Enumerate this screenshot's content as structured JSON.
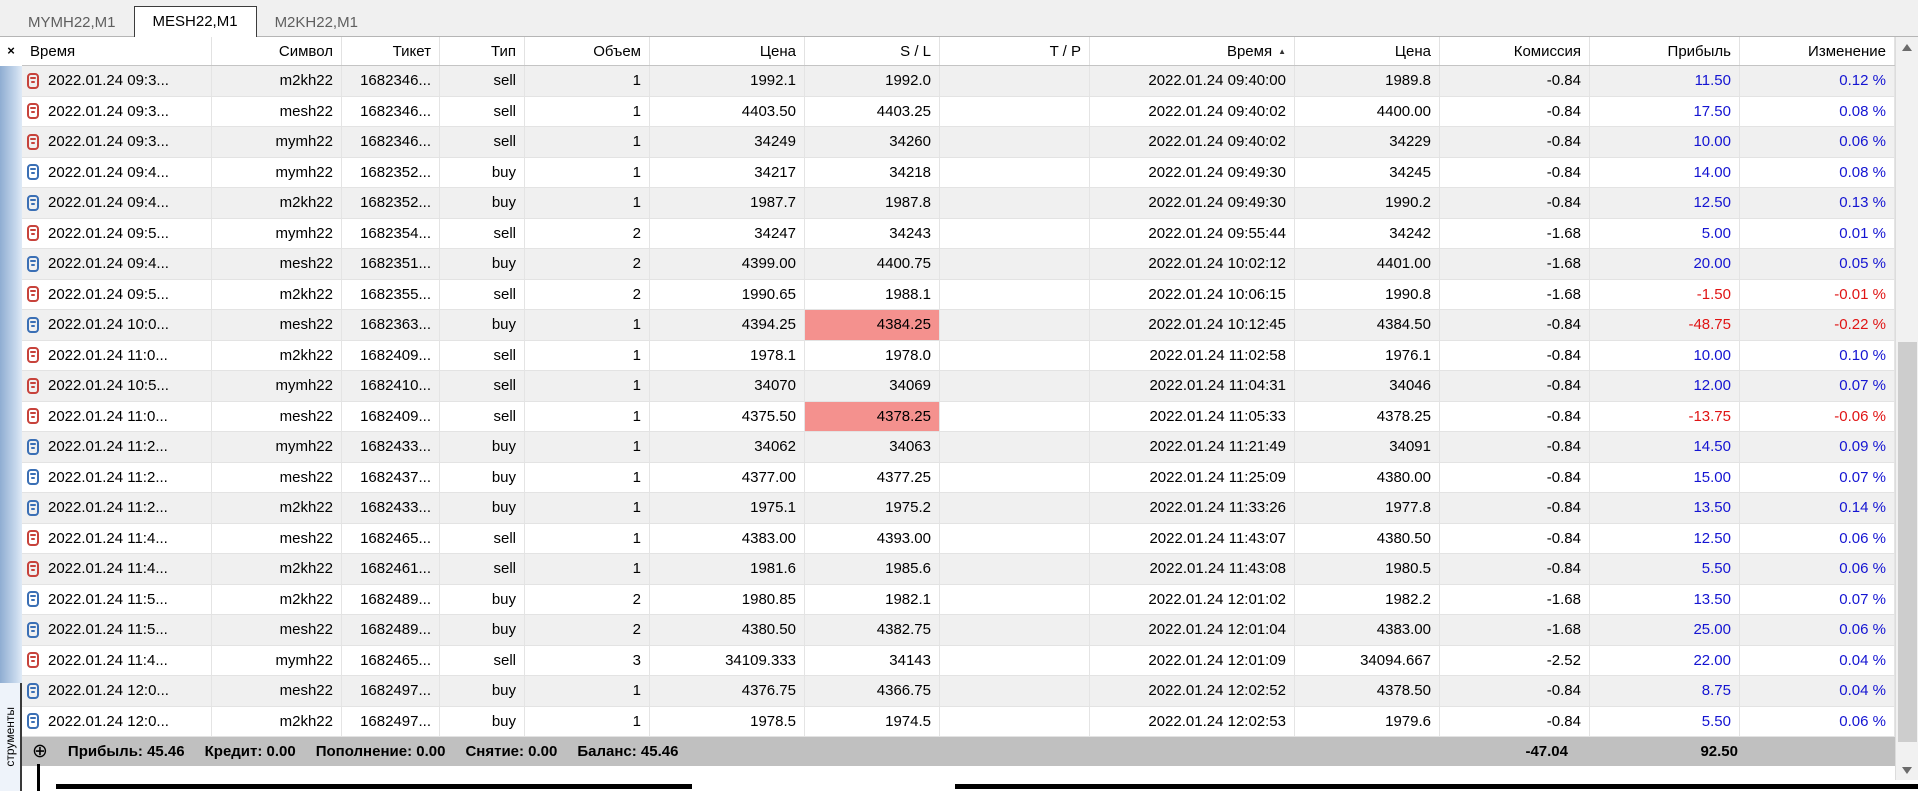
{
  "icons": {
    "close": "×",
    "sort_asc": "▲",
    "expand": "⊕"
  },
  "colors": {
    "profit_positive": "#1414d2",
    "profit_negative": "#e01414",
    "sl_alert_background": "#f4918e",
    "sell_icon": "#c7423b",
    "buy_icon": "#3a6fb5",
    "row_stripe": "#f0f0f0",
    "summary_background": "#c0c0c0",
    "sidebar_gradient": "#8fadd2"
  },
  "tabs": [
    {
      "label": "MYMH22,M1",
      "active": false
    },
    {
      "label": "MESH22,M1",
      "active": true
    },
    {
      "label": "M2KH22,M1",
      "active": false
    }
  ],
  "left_panel": {
    "vertical_label": "струменты"
  },
  "table": {
    "columns": [
      {
        "label": "Время",
        "align": "left"
      },
      {
        "label": "Символ",
        "align": "right"
      },
      {
        "label": "Тикет",
        "align": "right"
      },
      {
        "label": "Тип",
        "align": "right"
      },
      {
        "label": "Объем",
        "align": "right"
      },
      {
        "label": "Цена",
        "align": "right"
      },
      {
        "label": "S / L",
        "align": "right"
      },
      {
        "label": "T / P",
        "align": "right"
      },
      {
        "label": "Время",
        "align": "right",
        "sort": "asc"
      },
      {
        "label": "Цена",
        "align": "right"
      },
      {
        "label": "Комиссия",
        "align": "right"
      },
      {
        "label": "Прибыль",
        "align": "right"
      },
      {
        "label": "Изменение",
        "align": "right"
      }
    ],
    "rows": [
      {
        "time_open": "2022.01.24 09:3...",
        "symbol": "m2kh22",
        "ticket": "1682346...",
        "type": "sell",
        "volume": "1",
        "price_open": "1992.1",
        "sl": "1992.0",
        "tp": "",
        "time_close": "2022.01.24 09:40:00",
        "price_close": "1989.8",
        "commission": "-0.84",
        "profit": "11.50",
        "change": "0.12 %",
        "sl_alert": false
      },
      {
        "time_open": "2022.01.24 09:3...",
        "symbol": "mesh22",
        "ticket": "1682346...",
        "type": "sell",
        "volume": "1",
        "price_open": "4403.50",
        "sl": "4403.25",
        "tp": "",
        "time_close": "2022.01.24 09:40:02",
        "price_close": "4400.00",
        "commission": "-0.84",
        "profit": "17.50",
        "change": "0.08 %",
        "sl_alert": false
      },
      {
        "time_open": "2022.01.24 09:3...",
        "symbol": "mymh22",
        "ticket": "1682346...",
        "type": "sell",
        "volume": "1",
        "price_open": "34249",
        "sl": "34260",
        "tp": "",
        "time_close": "2022.01.24 09:40:02",
        "price_close": "34229",
        "commission": "-0.84",
        "profit": "10.00",
        "change": "0.06 %",
        "sl_alert": false
      },
      {
        "time_open": "2022.01.24 09:4...",
        "symbol": "mymh22",
        "ticket": "1682352...",
        "type": "buy",
        "volume": "1",
        "price_open": "34217",
        "sl": "34218",
        "tp": "",
        "time_close": "2022.01.24 09:49:30",
        "price_close": "34245",
        "commission": "-0.84",
        "profit": "14.00",
        "change": "0.08 %",
        "sl_alert": false
      },
      {
        "time_open": "2022.01.24 09:4...",
        "symbol": "m2kh22",
        "ticket": "1682352...",
        "type": "buy",
        "volume": "1",
        "price_open": "1987.7",
        "sl": "1987.8",
        "tp": "",
        "time_close": "2022.01.24 09:49:30",
        "price_close": "1990.2",
        "commission": "-0.84",
        "profit": "12.50",
        "change": "0.13 %",
        "sl_alert": false
      },
      {
        "time_open": "2022.01.24 09:5...",
        "symbol": "mymh22",
        "ticket": "1682354...",
        "type": "sell",
        "volume": "2",
        "price_open": "34247",
        "sl": "34243",
        "tp": "",
        "time_close": "2022.01.24 09:55:44",
        "price_close": "34242",
        "commission": "-1.68",
        "profit": "5.00",
        "change": "0.01 %",
        "sl_alert": false
      },
      {
        "time_open": "2022.01.24 09:4...",
        "symbol": "mesh22",
        "ticket": "1682351...",
        "type": "buy",
        "volume": "2",
        "price_open": "4399.00",
        "sl": "4400.75",
        "tp": "",
        "time_close": "2022.01.24 10:02:12",
        "price_close": "4401.00",
        "commission": "-1.68",
        "profit": "20.00",
        "change": "0.05 %",
        "sl_alert": false
      },
      {
        "time_open": "2022.01.24 09:5...",
        "symbol": "m2kh22",
        "ticket": "1682355...",
        "type": "sell",
        "volume": "2",
        "price_open": "1990.65",
        "sl": "1988.1",
        "tp": "",
        "time_close": "2022.01.24 10:06:15",
        "price_close": "1990.8",
        "commission": "-1.68",
        "profit": "-1.50",
        "change": "-0.01 %",
        "sl_alert": false
      },
      {
        "time_open": "2022.01.24 10:0...",
        "symbol": "mesh22",
        "ticket": "1682363...",
        "type": "buy",
        "volume": "1",
        "price_open": "4394.25",
        "sl": "4384.25",
        "tp": "",
        "time_close": "2022.01.24 10:12:45",
        "price_close": "4384.50",
        "commission": "-0.84",
        "profit": "-48.75",
        "change": "-0.22 %",
        "sl_alert": true
      },
      {
        "time_open": "2022.01.24 11:0...",
        "symbol": "m2kh22",
        "ticket": "1682409...",
        "type": "sell",
        "volume": "1",
        "price_open": "1978.1",
        "sl": "1978.0",
        "tp": "",
        "time_close": "2022.01.24 11:02:58",
        "price_close": "1976.1",
        "commission": "-0.84",
        "profit": "10.00",
        "change": "0.10 %",
        "sl_alert": false
      },
      {
        "time_open": "2022.01.24 10:5...",
        "symbol": "mymh22",
        "ticket": "1682410...",
        "type": "sell",
        "volume": "1",
        "price_open": "34070",
        "sl": "34069",
        "tp": "",
        "time_close": "2022.01.24 11:04:31",
        "price_close": "34046",
        "commission": "-0.84",
        "profit": "12.00",
        "change": "0.07 %",
        "sl_alert": false
      },
      {
        "time_open": "2022.01.24 11:0...",
        "symbol": "mesh22",
        "ticket": "1682409...",
        "type": "sell",
        "volume": "1",
        "price_open": "4375.50",
        "sl": "4378.25",
        "tp": "",
        "time_close": "2022.01.24 11:05:33",
        "price_close": "4378.25",
        "commission": "-0.84",
        "profit": "-13.75",
        "change": "-0.06 %",
        "sl_alert": true
      },
      {
        "time_open": "2022.01.24 11:2...",
        "symbol": "mymh22",
        "ticket": "1682433...",
        "type": "buy",
        "volume": "1",
        "price_open": "34062",
        "sl": "34063",
        "tp": "",
        "time_close": "2022.01.24 11:21:49",
        "price_close": "34091",
        "commission": "-0.84",
        "profit": "14.50",
        "change": "0.09 %",
        "sl_alert": false
      },
      {
        "time_open": "2022.01.24 11:2...",
        "symbol": "mesh22",
        "ticket": "1682437...",
        "type": "buy",
        "volume": "1",
        "price_open": "4377.00",
        "sl": "4377.25",
        "tp": "",
        "time_close": "2022.01.24 11:25:09",
        "price_close": "4380.00",
        "commission": "-0.84",
        "profit": "15.00",
        "change": "0.07 %",
        "sl_alert": false
      },
      {
        "time_open": "2022.01.24 11:2...",
        "symbol": "m2kh22",
        "ticket": "1682433...",
        "type": "buy",
        "volume": "1",
        "price_open": "1975.1",
        "sl": "1975.2",
        "tp": "",
        "time_close": "2022.01.24 11:33:26",
        "price_close": "1977.8",
        "commission": "-0.84",
        "profit": "13.50",
        "change": "0.14 %",
        "sl_alert": false
      },
      {
        "time_open": "2022.01.24 11:4...",
        "symbol": "mesh22",
        "ticket": "1682465...",
        "type": "sell",
        "volume": "1",
        "price_open": "4383.00",
        "sl": "4393.00",
        "tp": "",
        "time_close": "2022.01.24 11:43:07",
        "price_close": "4380.50",
        "commission": "-0.84",
        "profit": "12.50",
        "change": "0.06 %",
        "sl_alert": false
      },
      {
        "time_open": "2022.01.24 11:4...",
        "symbol": "m2kh22",
        "ticket": "1682461...",
        "type": "sell",
        "volume": "1",
        "price_open": "1981.6",
        "sl": "1985.6",
        "tp": "",
        "time_close": "2022.01.24 11:43:08",
        "price_close": "1980.5",
        "commission": "-0.84",
        "profit": "5.50",
        "change": "0.06 %",
        "sl_alert": false
      },
      {
        "time_open": "2022.01.24 11:5...",
        "symbol": "m2kh22",
        "ticket": "1682489...",
        "type": "buy",
        "volume": "2",
        "price_open": "1980.85",
        "sl": "1982.1",
        "tp": "",
        "time_close": "2022.01.24 12:01:02",
        "price_close": "1982.2",
        "commission": "-1.68",
        "profit": "13.50",
        "change": "0.07 %",
        "sl_alert": false
      },
      {
        "time_open": "2022.01.24 11:5...",
        "symbol": "mesh22",
        "ticket": "1682489...",
        "type": "buy",
        "volume": "2",
        "price_open": "4380.50",
        "sl": "4382.75",
        "tp": "",
        "time_close": "2022.01.24 12:01:04",
        "price_close": "4383.00",
        "commission": "-1.68",
        "profit": "25.00",
        "change": "0.06 %",
        "sl_alert": false
      },
      {
        "time_open": "2022.01.24 11:4...",
        "symbol": "mymh22",
        "ticket": "1682465...",
        "type": "sell",
        "volume": "3",
        "price_open": "34109.333",
        "sl": "34143",
        "tp": "",
        "time_close": "2022.01.24 12:01:09",
        "price_close": "34094.667",
        "commission": "-2.52",
        "profit": "22.00",
        "change": "0.04 %",
        "sl_alert": false
      },
      {
        "time_open": "2022.01.24 12:0...",
        "symbol": "mesh22",
        "ticket": "1682497...",
        "type": "buy",
        "volume": "1",
        "price_open": "4376.75",
        "sl": "4366.75",
        "tp": "",
        "time_close": "2022.01.24 12:02:52",
        "price_close": "4378.50",
        "commission": "-0.84",
        "profit": "8.75",
        "change": "0.04 %",
        "sl_alert": false
      },
      {
        "time_open": "2022.01.24 12:0...",
        "symbol": "m2kh22",
        "ticket": "1682497...",
        "type": "buy",
        "volume": "1",
        "price_open": "1978.5",
        "sl": "1974.5",
        "tp": "",
        "time_close": "2022.01.24 12:02:53",
        "price_close": "1979.6",
        "commission": "-0.84",
        "profit": "5.50",
        "change": "0.06 %",
        "sl_alert": false
      }
    ]
  },
  "summary": {
    "items": [
      "Прибыль: 45.46",
      "Кредит: 0.00",
      "Пополнение: 0.00",
      "Снятие: 0.00",
      "Баланс: 45.46"
    ],
    "commission_total": "-47.04",
    "profit_total": "92.50"
  }
}
